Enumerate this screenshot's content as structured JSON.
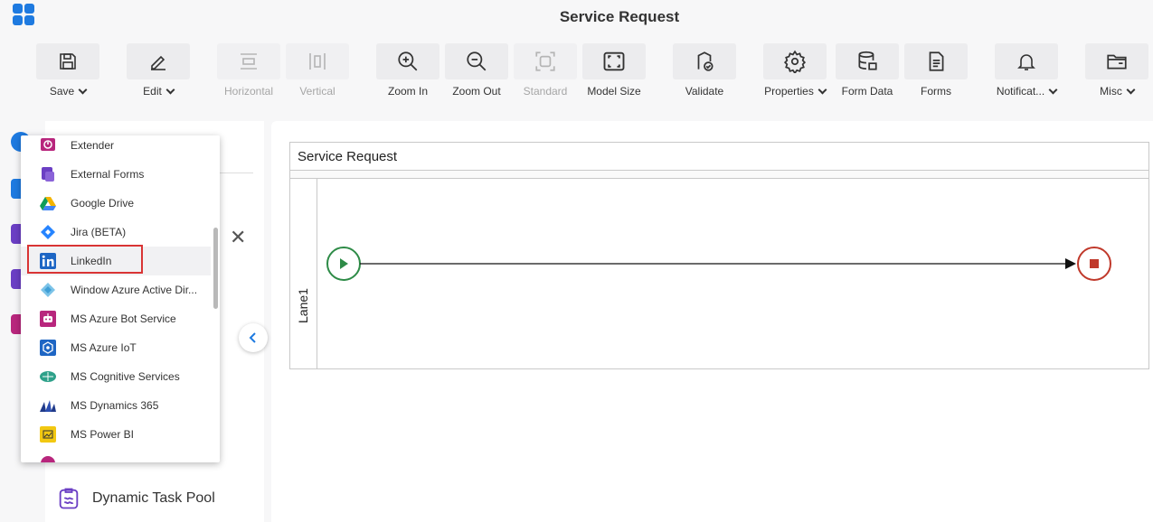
{
  "app": {
    "title": "Service Request"
  },
  "toolbar": {
    "save": "Save",
    "edit": "Edit",
    "horizontal": "Horizontal",
    "vertical": "Vertical",
    "zoom_in": "Zoom In",
    "zoom_out": "Zoom Out",
    "standard": "Standard",
    "model_size": "Model Size",
    "validate": "Validate",
    "properties": "Properties",
    "form_data": "Form Data",
    "forms": "Forms",
    "notifications": "Notificat...",
    "misc": "Misc"
  },
  "dropdown": {
    "items": [
      {
        "label": "Extender",
        "icon": "extender-icon"
      },
      {
        "label": "External Forms",
        "icon": "external-forms-icon"
      },
      {
        "label": "Google Drive",
        "icon": "google-drive-icon"
      },
      {
        "label": "Jira (BETA)",
        "icon": "jira-icon"
      },
      {
        "label": "LinkedIn",
        "icon": "linkedin-icon"
      },
      {
        "label": "Window Azure Active Dir...",
        "icon": "azure-ad-icon"
      },
      {
        "label": "MS Azure Bot Service",
        "icon": "bot-icon"
      },
      {
        "label": "MS Azure IoT",
        "icon": "iot-icon"
      },
      {
        "label": "MS Cognitive Services",
        "icon": "cognitive-icon"
      },
      {
        "label": "MS Dynamics 365",
        "icon": "dynamics-icon"
      },
      {
        "label": "MS Power BI",
        "icon": "powerbi-icon"
      }
    ],
    "highlighted": "LinkedIn"
  },
  "palette": {
    "dynamic_task_pool": "Dynamic Task Pool"
  },
  "diagram": {
    "pool_title": "Service Request",
    "lane_label": "Lane1"
  },
  "colors": {
    "accent": "#1e7ae0",
    "highlight_border": "#d93434",
    "start": "#2e8b47",
    "end": "#c0392b"
  }
}
